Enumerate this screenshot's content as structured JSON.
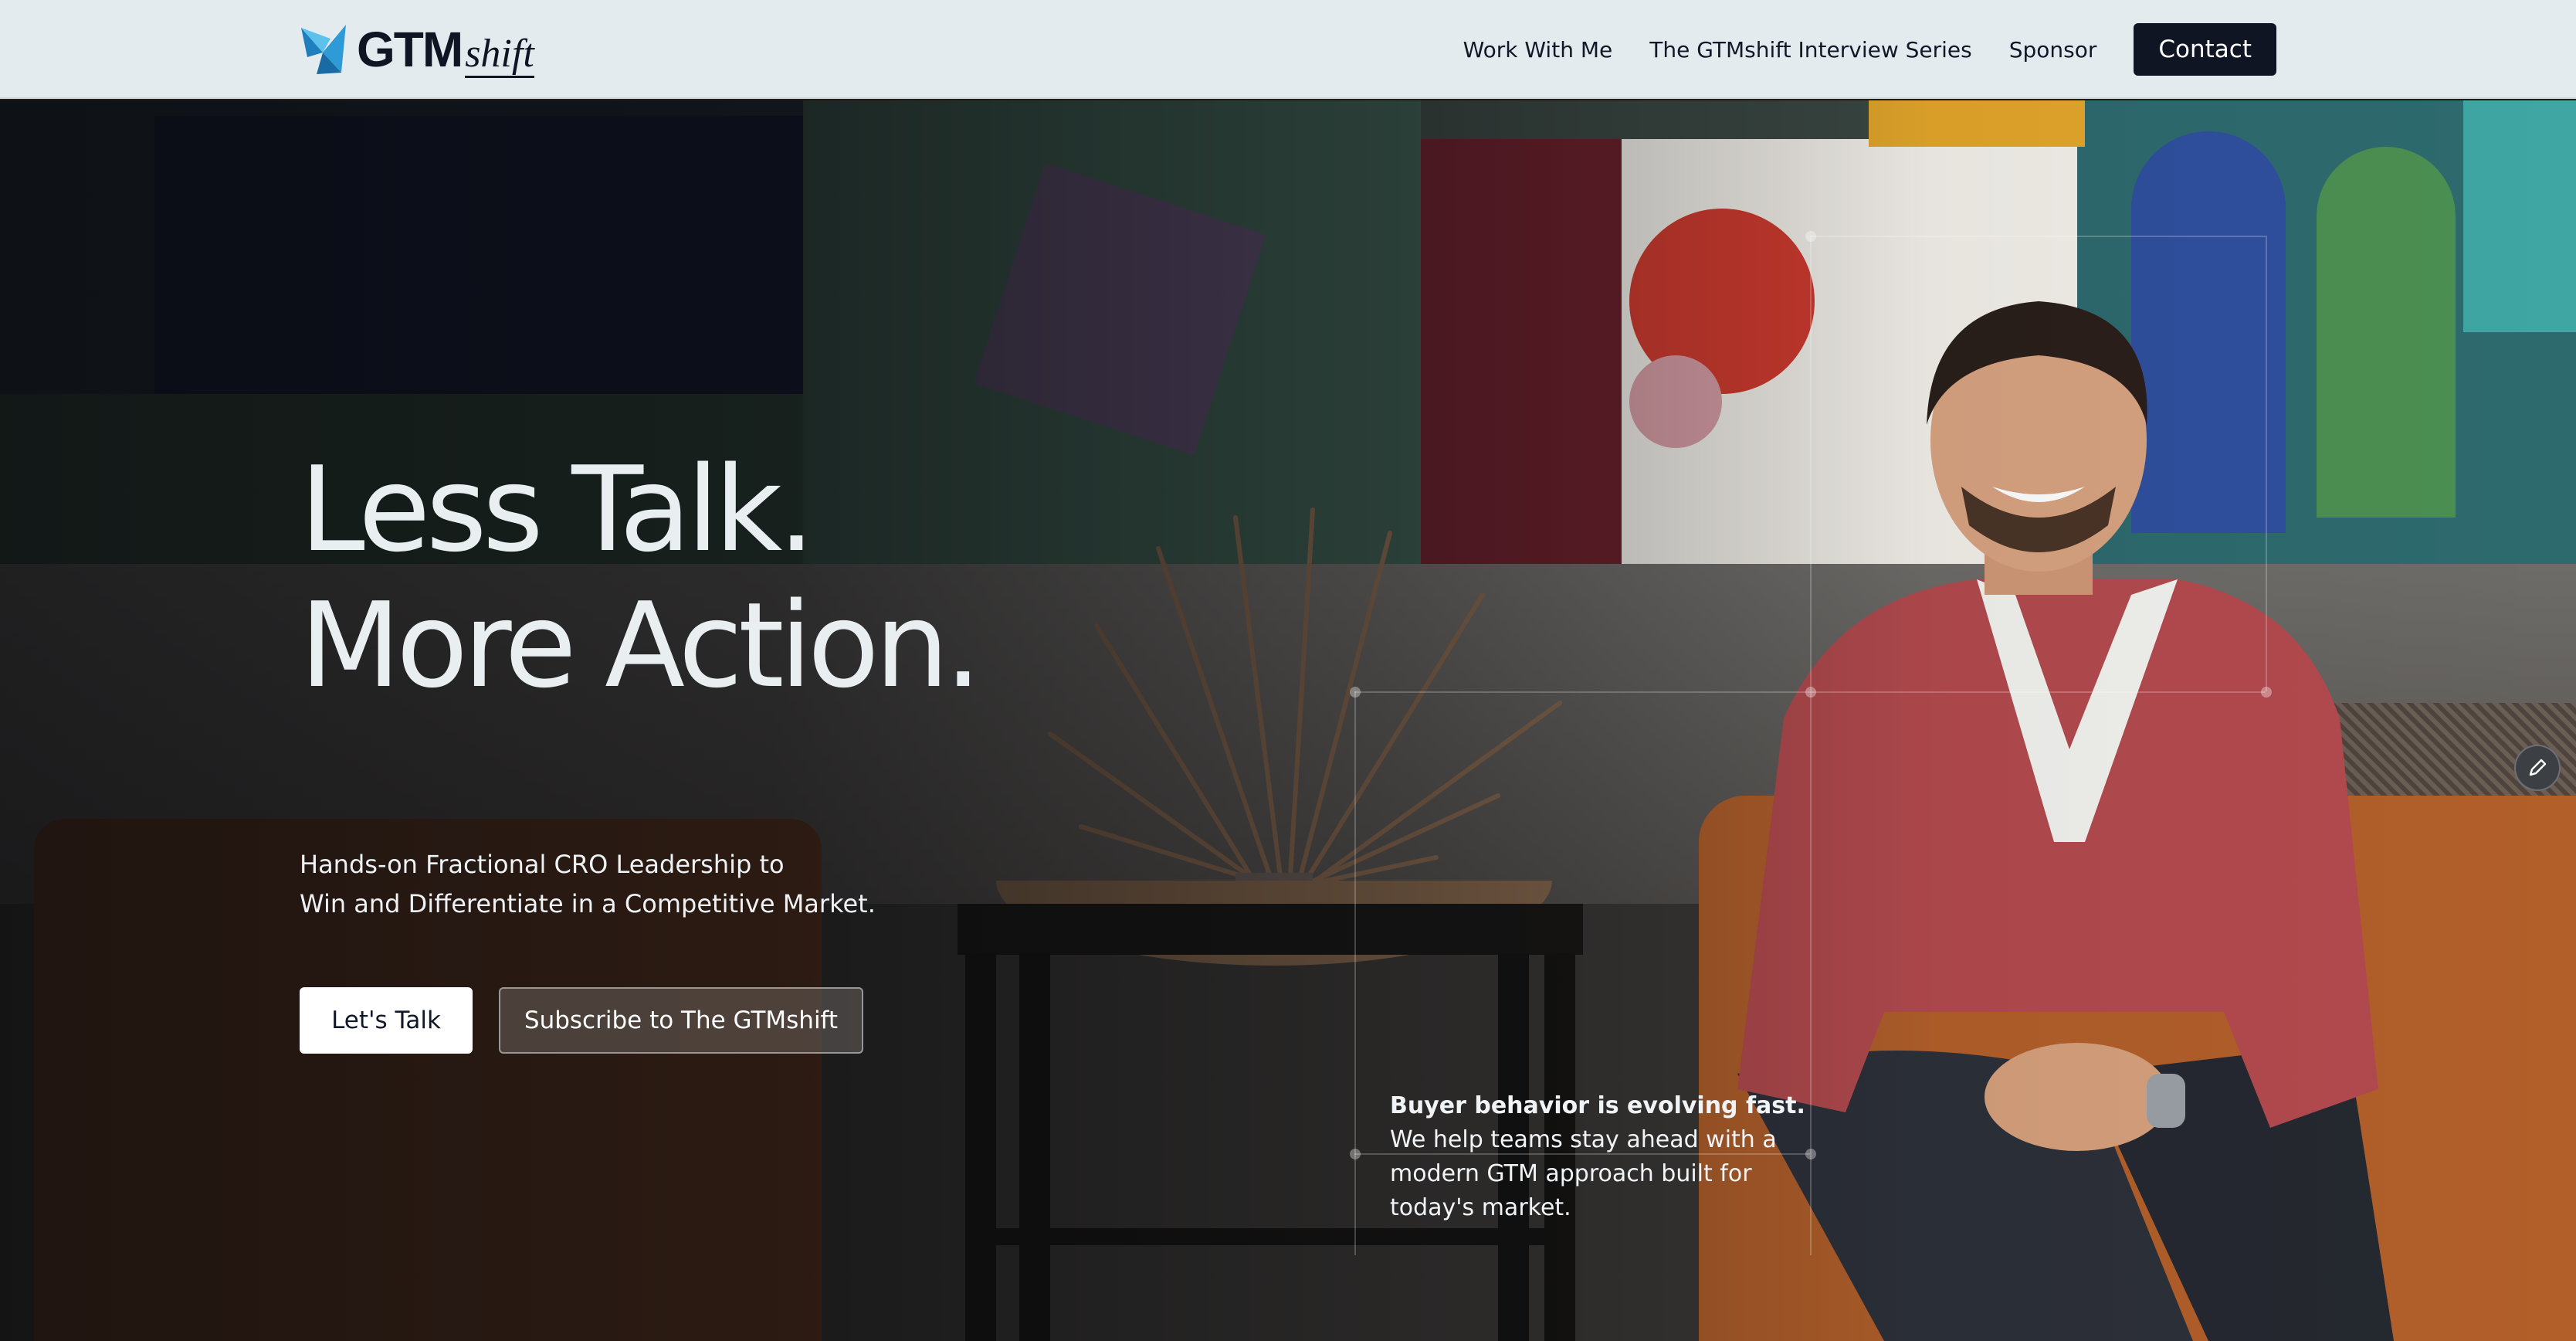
{
  "header": {
    "logo": {
      "brand": "GTM",
      "suffix": "shift"
    },
    "nav": [
      {
        "label": "Work With Me"
      },
      {
        "label": "The GTMshift Interview Series"
      },
      {
        "label": "Sponsor"
      }
    ],
    "contact_label": "Contact"
  },
  "hero": {
    "headline_line1": "Less Talk.",
    "headline_line2": "More Action.",
    "subhead_line1": "Hands-on Fractional CRO Leadership to",
    "subhead_line2": "Win and Differentiate in a Competitive Market.",
    "primary_cta": "Let's Talk",
    "secondary_cta": "Subscribe to The GTMshift",
    "callout": {
      "title": "Buyer behavior is evolving fast.",
      "body_line1": "We help teams stay ahead with a",
      "body_line2": "modern GTM approach built for",
      "body_line3": "today's market."
    },
    "edit_icon": "pencil-icon"
  },
  "colors": {
    "header_bg": "#e4ebee",
    "brand_dark": "#0f1523",
    "logo_blue": "#2f9bd6",
    "headline_text": "#e9eef1",
    "blazer_red": "#b34a4e"
  }
}
